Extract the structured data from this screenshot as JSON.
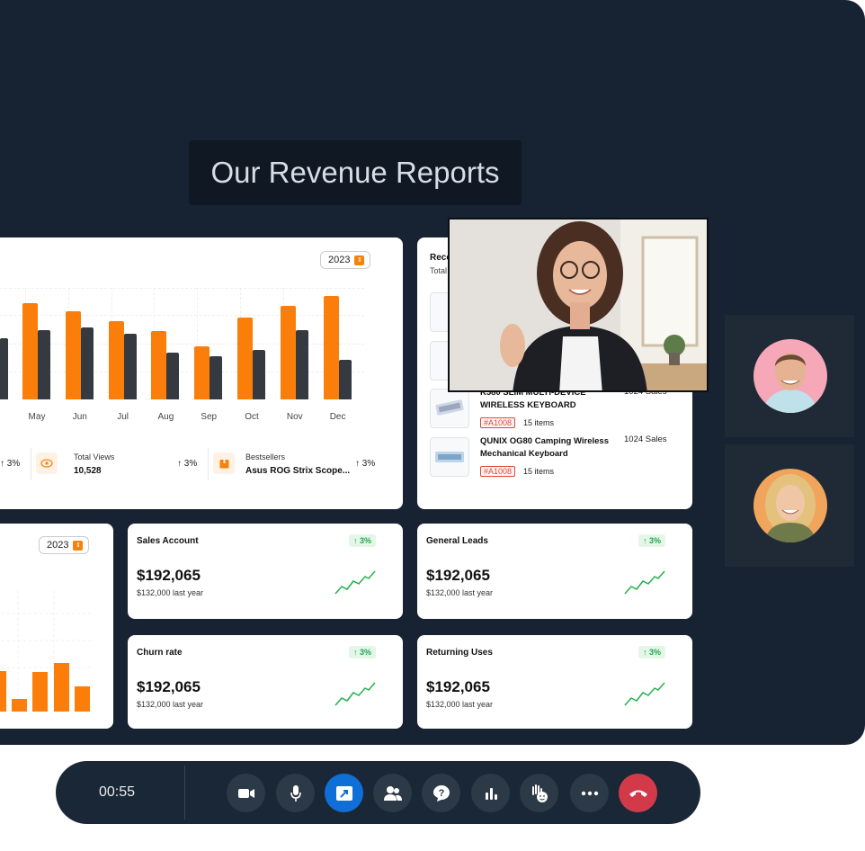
{
  "presentation": {
    "title": "Our Revenue Reports"
  },
  "revenue_chart": {
    "year": "2023",
    "months": [
      "May",
      "Jun",
      "Jul",
      "Aug",
      "Sep",
      "Oct",
      "Nov",
      "Dec"
    ],
    "orange_heights": [
      107,
      98,
      87,
      76,
      59,
      91,
      104,
      115
    ],
    "dark_heights": [
      77,
      80,
      73,
      52,
      48,
      55,
      77,
      44
    ]
  },
  "stats": {
    "first_pct": "3%",
    "total_views_label": "Total Views",
    "total_views_value": "10,528",
    "total_views_pct": "3%",
    "bestsellers_label": "Bestsellers",
    "bestsellers_value": "Asus ROG Strix Scope...",
    "bestsellers_pct": "3%"
  },
  "orders": {
    "title_partial": "Rece",
    "subtitle_partial": "Total",
    "items": [
      {
        "name_line1": "K580 SLIM MULTI-DEVICE",
        "name_line2": "WIRELESS KEYBOARD",
        "tag": "#A1008",
        "items": "15 items",
        "sales": "1024 Sales"
      },
      {
        "name_line1": "QUNIX OG80 Camping Wireless",
        "name_line2": "Mechanical Keyboard",
        "tag": "#A1008",
        "items": "15 items",
        "sales": "1024 Sales"
      }
    ]
  },
  "small_chart": {
    "year": "2023"
  },
  "kpis": [
    {
      "title": "Sales Account",
      "badge": "3%",
      "value": "$192,065",
      "sub": "$132,000 last year"
    },
    {
      "title": "General Leads",
      "badge": "3%",
      "value": "$192,065",
      "sub": "$132,000 last year"
    },
    {
      "title": "Churn rate",
      "badge": "3%",
      "value": "$192,065",
      "sub": "$132,000 last year"
    },
    {
      "title": "Returning Uses",
      "badge": "3%",
      "value": "$192,065",
      "sub": "$132,000 last year"
    }
  ],
  "call": {
    "timer": "00:55",
    "buttons": [
      "camera-icon",
      "microphone-icon",
      "share-screen-icon",
      "participants-icon",
      "help-icon",
      "stats-icon",
      "raise-hand-icon",
      "more-icon",
      "end-call-icon"
    ],
    "accent_color": "#0f6fd6",
    "end_color": "#d23a4a"
  },
  "colors": {
    "bar_primary": "#fb7e0a",
    "bar_secondary": "#343a40",
    "positive": "#1faa4a"
  }
}
